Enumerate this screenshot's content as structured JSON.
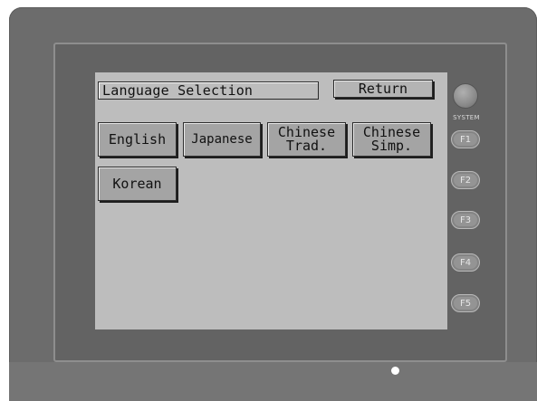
{
  "screen": {
    "title": "Language Selection",
    "return_label": "Return",
    "languages": [
      {
        "id": "english",
        "label": "English"
      },
      {
        "id": "japanese",
        "label": "Japanese"
      },
      {
        "id": "chinese-trad",
        "label": "Chinese\nTrad."
      },
      {
        "id": "chinese-simp",
        "label": "Chinese\nSimp."
      },
      {
        "id": "korean",
        "label": "Korean"
      }
    ]
  },
  "device": {
    "system_label": "SYSTEM",
    "function_keys": [
      "F1",
      "F2",
      "F3",
      "F4",
      "F5"
    ],
    "colors": {
      "body": "#6c6c6c",
      "screen": "#bdbdbd",
      "button": "#a4a4a4",
      "led": "#ffffff"
    }
  }
}
